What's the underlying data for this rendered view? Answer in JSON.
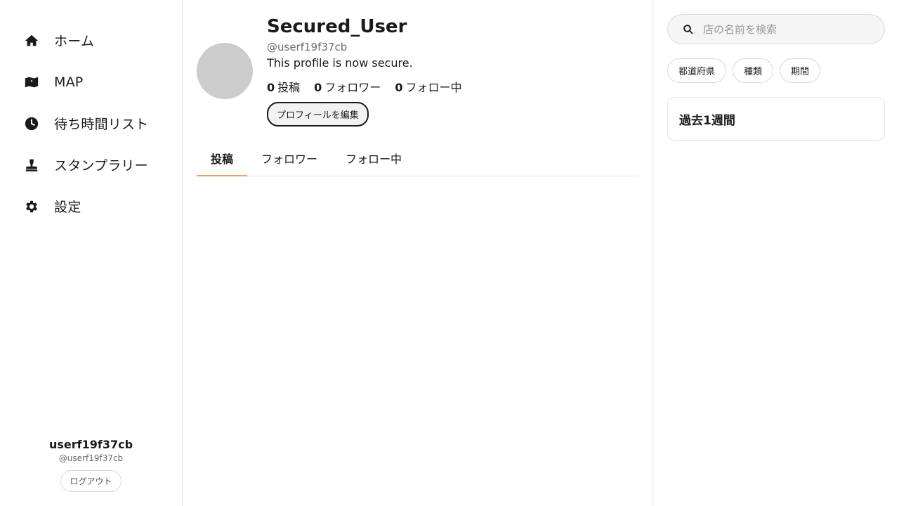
{
  "sidebar": {
    "items": [
      {
        "label": "ホーム",
        "icon": "home-icon"
      },
      {
        "label": "MAP",
        "icon": "map-icon"
      },
      {
        "label": "待ち時間リスト",
        "icon": "clock-icon"
      },
      {
        "label": "スタンプラリー",
        "icon": "stamp-icon"
      },
      {
        "label": "設定",
        "icon": "gear-icon"
      }
    ],
    "user": {
      "name": "userf19f37cb",
      "handle": "@userf19f37cb",
      "logout_label": "ログアウト"
    }
  },
  "profile": {
    "display_name": "Secured_User",
    "handle": "@userf19f37cb",
    "bio": "This profile is now secure.",
    "stats": [
      {
        "count": "0",
        "label": "投稿"
      },
      {
        "count": "0",
        "label": "フォロワー"
      },
      {
        "count": "0",
        "label": "フォロー中"
      }
    ],
    "edit_label": "プロフィールを編集"
  },
  "tabs": [
    {
      "label": "投稿",
      "active": true
    },
    {
      "label": "フォロワー",
      "active": false
    },
    {
      "label": "フォロー中",
      "active": false
    }
  ],
  "right": {
    "search": {
      "placeholder": "店の名前を検索",
      "value": ""
    },
    "filters": [
      {
        "label": "都道府県"
      },
      {
        "label": "種類"
      },
      {
        "label": "期間"
      }
    ],
    "period_title": "過去1週間"
  },
  "colors": {
    "tab_indicator": "#e0a472",
    "avatar_placeholder": "#cccccc"
  }
}
